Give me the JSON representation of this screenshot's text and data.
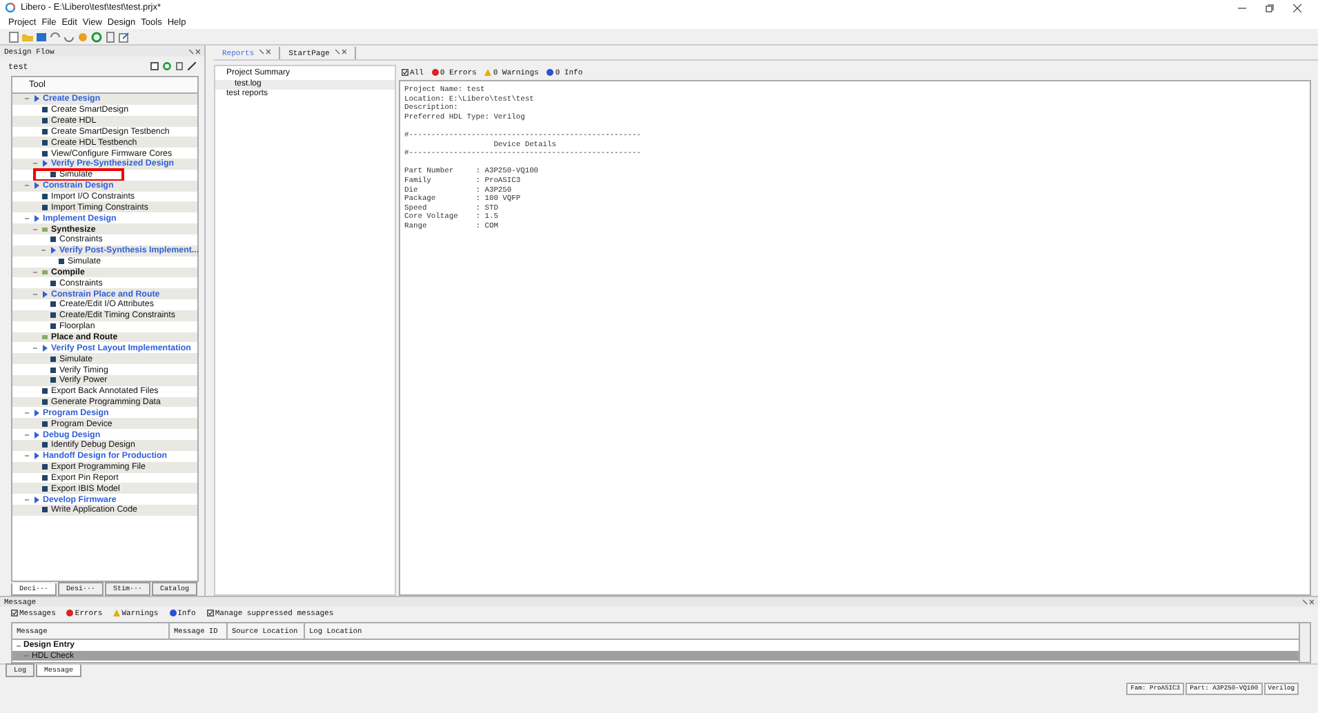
{
  "window": {
    "title": "Libero - E:\\Libero\\test\\test\\test.prjx*"
  },
  "menu": [
    "Project",
    "File",
    "Edit",
    "View",
    "Design",
    "Tools",
    "Help"
  ],
  "design_flow": {
    "title": "Design Flow",
    "project": "test",
    "column": "Tool",
    "tree": [
      {
        "label": "Create Design",
        "kind": "category",
        "expanded": true,
        "children": [
          {
            "label": "Create SmartDesign",
            "kind": "tool"
          },
          {
            "label": "Create HDL",
            "kind": "tool"
          },
          {
            "label": "Create SmartDesign Testbench",
            "kind": "tool"
          },
          {
            "label": "Create HDL Testbench",
            "kind": "tool"
          },
          {
            "label": "View/Configure Firmware Cores",
            "kind": "tool"
          },
          {
            "label": "Verify Pre-Synthesized Design",
            "kind": "category",
            "expanded": true,
            "children": [
              {
                "label": "Simulate",
                "kind": "tool",
                "highlighted": true
              }
            ]
          }
        ]
      },
      {
        "label": "Constrain Design",
        "kind": "category",
        "expanded": true,
        "children": [
          {
            "label": "Import I/O Constraints",
            "kind": "tool"
          },
          {
            "label": "Import Timing Constraints",
            "kind": "tool"
          }
        ]
      },
      {
        "label": "Implement Design",
        "kind": "category",
        "expanded": true,
        "children": [
          {
            "label": "Synthesize",
            "kind": "group",
            "expanded": true,
            "children": [
              {
                "label": "Constraints",
                "kind": "tool"
              },
              {
                "label": "Verify Post-Synthesis Implement...",
                "kind": "category",
                "expanded": true,
                "children": [
                  {
                    "label": "Simulate",
                    "kind": "tool"
                  }
                ]
              }
            ]
          },
          {
            "label": "Compile",
            "kind": "group",
            "expanded": true,
            "children": [
              {
                "label": "Constraints",
                "kind": "tool"
              }
            ]
          },
          {
            "label": "Constrain Place and Route",
            "kind": "category",
            "expanded": true,
            "children": [
              {
                "label": "Create/Edit I/O Attributes",
                "kind": "tool"
              },
              {
                "label": "Create/Edit Timing Constraints",
                "kind": "tool"
              },
              {
                "label": "Floorplan",
                "kind": "tool"
              }
            ]
          },
          {
            "label": "Place and Route",
            "kind": "group"
          },
          {
            "label": "Verify Post Layout Implementation",
            "kind": "category",
            "expanded": true,
            "children": [
              {
                "label": "Simulate",
                "kind": "tool"
              },
              {
                "label": "Verify Timing",
                "kind": "tool"
              },
              {
                "label": "Verify Power",
                "kind": "tool"
              }
            ]
          },
          {
            "label": "Export Back Annotated Files",
            "kind": "tool"
          },
          {
            "label": "Generate Programming Data",
            "kind": "tool"
          }
        ]
      },
      {
        "label": "Program Design",
        "kind": "category",
        "expanded": true,
        "children": [
          {
            "label": "Program Device",
            "kind": "tool"
          }
        ]
      },
      {
        "label": "Debug Design",
        "kind": "category",
        "expanded": true,
        "children": [
          {
            "label": "Identify Debug Design",
            "kind": "tool"
          }
        ]
      },
      {
        "label": "Handoff Design for Production",
        "kind": "category",
        "expanded": true,
        "children": [
          {
            "label": "Export Programming File",
            "kind": "tool"
          },
          {
            "label": "Export Pin Report",
            "kind": "tool"
          },
          {
            "label": "Export IBIS Model",
            "kind": "tool"
          }
        ]
      },
      {
        "label": "Develop Firmware",
        "kind": "category",
        "expanded": true,
        "children": [
          {
            "label": "Write Application Code",
            "kind": "tool"
          }
        ]
      }
    ],
    "tabs": [
      {
        "label": "Deci···",
        "selected": true
      },
      {
        "label": "Desi···",
        "selected": false
      },
      {
        "label": "Stim···",
        "selected": false
      },
      {
        "label": "Catalog",
        "selected": false
      }
    ]
  },
  "editor_tabs": [
    {
      "label": "Reports",
      "selected": true
    },
    {
      "label": "StartPage",
      "selected": false
    }
  ],
  "reports": {
    "items": [
      {
        "label": "Project Summary",
        "selected": false,
        "children": [
          {
            "label": "test.log",
            "selected": true
          }
        ]
      },
      {
        "label": "test reports",
        "selected": false
      }
    ],
    "filters": [
      {
        "label": "All",
        "kind": "check"
      },
      {
        "label": "0 Errors",
        "kind": "error"
      },
      {
        "label": "0 Warnings",
        "kind": "warning"
      },
      {
        "label": "0 Info",
        "kind": "info"
      }
    ],
    "blocks": [
      [
        "Project Name: test",
        "Location: E:\\Libero\\test\\test",
        "Description:",
        "Preferred HDL Type: Verilog"
      ],
      [
        "#----------------------------------------------------",
        "                    Device Details",
        "#----------------------------------------------------"
      ],
      [
        "Part Number     : A3P250-VQ100",
        "Family          : ProASIC3",
        "Die             : A3P250",
        "Package         : 100 VQFP",
        "Speed           : STD",
        "Core Voltage    : 1.5",
        "Range           : COM"
      ]
    ]
  },
  "message_panel": {
    "title": "Message",
    "filters": [
      {
        "label": "Messages",
        "kind": "check"
      },
      {
        "label": "Errors",
        "kind": "error"
      },
      {
        "label": "Warnings",
        "kind": "warning"
      },
      {
        "label": "Info",
        "kind": "info"
      },
      {
        "label": "Manage suppressed messages",
        "kind": "check"
      }
    ],
    "columns": [
      "Message",
      "Message ID",
      "Source Location",
      "Log Location"
    ],
    "rows": [
      {
        "label": "Design Entry",
        "selected": false,
        "expanded": true,
        "children": [
          {
            "label": "HDL Check",
            "selected": true
          }
        ]
      }
    ],
    "tabs": [
      {
        "label": "Log",
        "selected": false
      },
      {
        "label": "Message",
        "selected": true
      }
    ]
  },
  "status_bar": [
    "Fam: ProASIC3",
    "Part: A3P250-VQ100",
    "Verilog"
  ]
}
